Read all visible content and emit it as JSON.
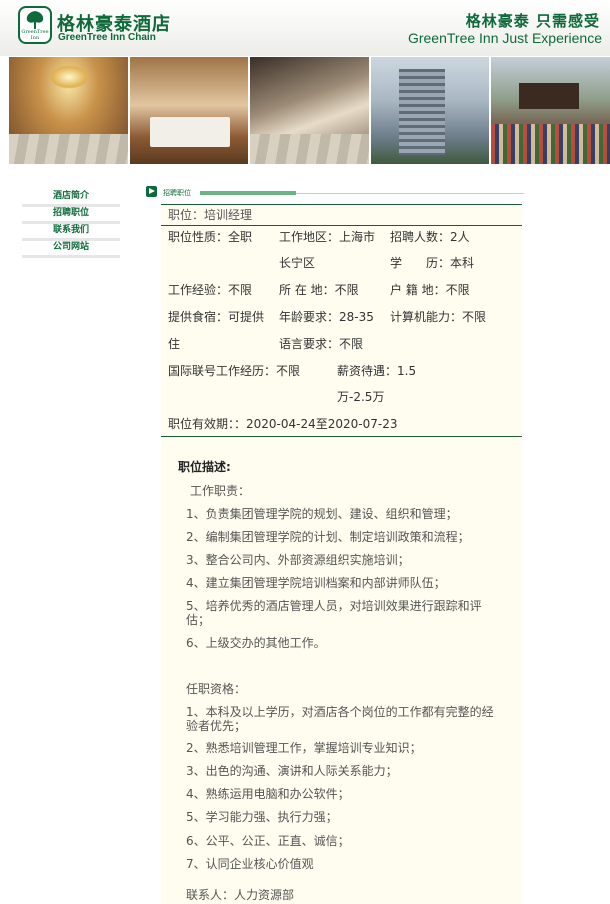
{
  "header": {
    "logo_emblem_line1": "GreenTree",
    "logo_emblem_line2": "Inn",
    "brand_cn": "格林豪泰酒店",
    "brand_en": "GreenTree Inn Chain",
    "slogan_cn": "格林豪泰  只需感受",
    "slogan_en": "GreenTree Inn Just Experience",
    "brand_color": "#0e6a3a"
  },
  "banner": {
    "photos": [
      "hotel-lobby-photo",
      "hotel-room-photo",
      "hotel-restaurant-photo",
      "hotel-building-photo",
      "staff-group-photo"
    ]
  },
  "sidebar": {
    "items": [
      {
        "label": "酒店简介"
      },
      {
        "label": "招聘职位"
      },
      {
        "label": "联系我们"
      },
      {
        "label": "公司网站"
      }
    ]
  },
  "section": {
    "tab_label": "招聘职位"
  },
  "job": {
    "title_label": "职位：",
    "title_value": "培训经理",
    "nature_label": "职位性质：",
    "nature_value": "全职",
    "area_label": "工作地区：",
    "area_value_1": "上海市",
    "area_value_2": "长宁区",
    "headcount_label": "招聘人数：",
    "headcount_value": "2人",
    "education_label": "学　　历：",
    "education_value": "本科",
    "experience_label": "工作经验：",
    "experience_value": "不限",
    "location_label": "所 在 地：",
    "location_value": "不限",
    "hukou_label": "户 籍 地：",
    "hukou_value": "不限",
    "meals_label": "提供食宿：",
    "meals_value_1": "可提供",
    "meals_value_2": "住",
    "age_label": "年龄要求：",
    "age_value": "28-35",
    "computer_label": "计算机能力：",
    "computer_value": "不限",
    "language_label": "语言要求：",
    "language_value": "不限",
    "intl_label": "国际联号工作经历：",
    "intl_value": "不限",
    "salary_label": "薪资待遇：",
    "salary_value_1": "1.5",
    "salary_value_2": "万-2.5万",
    "validity_label": "职位有效期：：",
    "validity_value": "2020-04-24至2020-07-23"
  },
  "description": {
    "title": "职位描述:",
    "duties_heading": "工作职责：",
    "duties": [
      "1、负责集团管理学院的规划、建设、组织和管理；",
      "2、编制集团管理学院的计划、制定培训政策和流程；",
      "3、整合公司内、外部资源组织实施培训；",
      "4、建立集团管理学院培训档案和内部讲师队伍；",
      "5、培养优秀的酒店管理人员，对培训效果进行跟踪和评估；",
      "6、上级交办的其他工作。"
    ],
    "qualifications_heading": "任职资格：",
    "qualifications": [
      "1、本科及以上学历，对酒店各个岗位的工作都有完整的经验者优先；",
      "2、熟悉培训管理工作，掌握培训专业知识；",
      "3、出色的沟通、演讲和人际关系能力；",
      "4、熟练运用电脑和办公软件；",
      "5、学习能力强、执行力强；",
      "6、公平、公正、正直、诚信；",
      "7、认同企业核心价值观"
    ],
    "contact": "联系人：人力资源部"
  }
}
